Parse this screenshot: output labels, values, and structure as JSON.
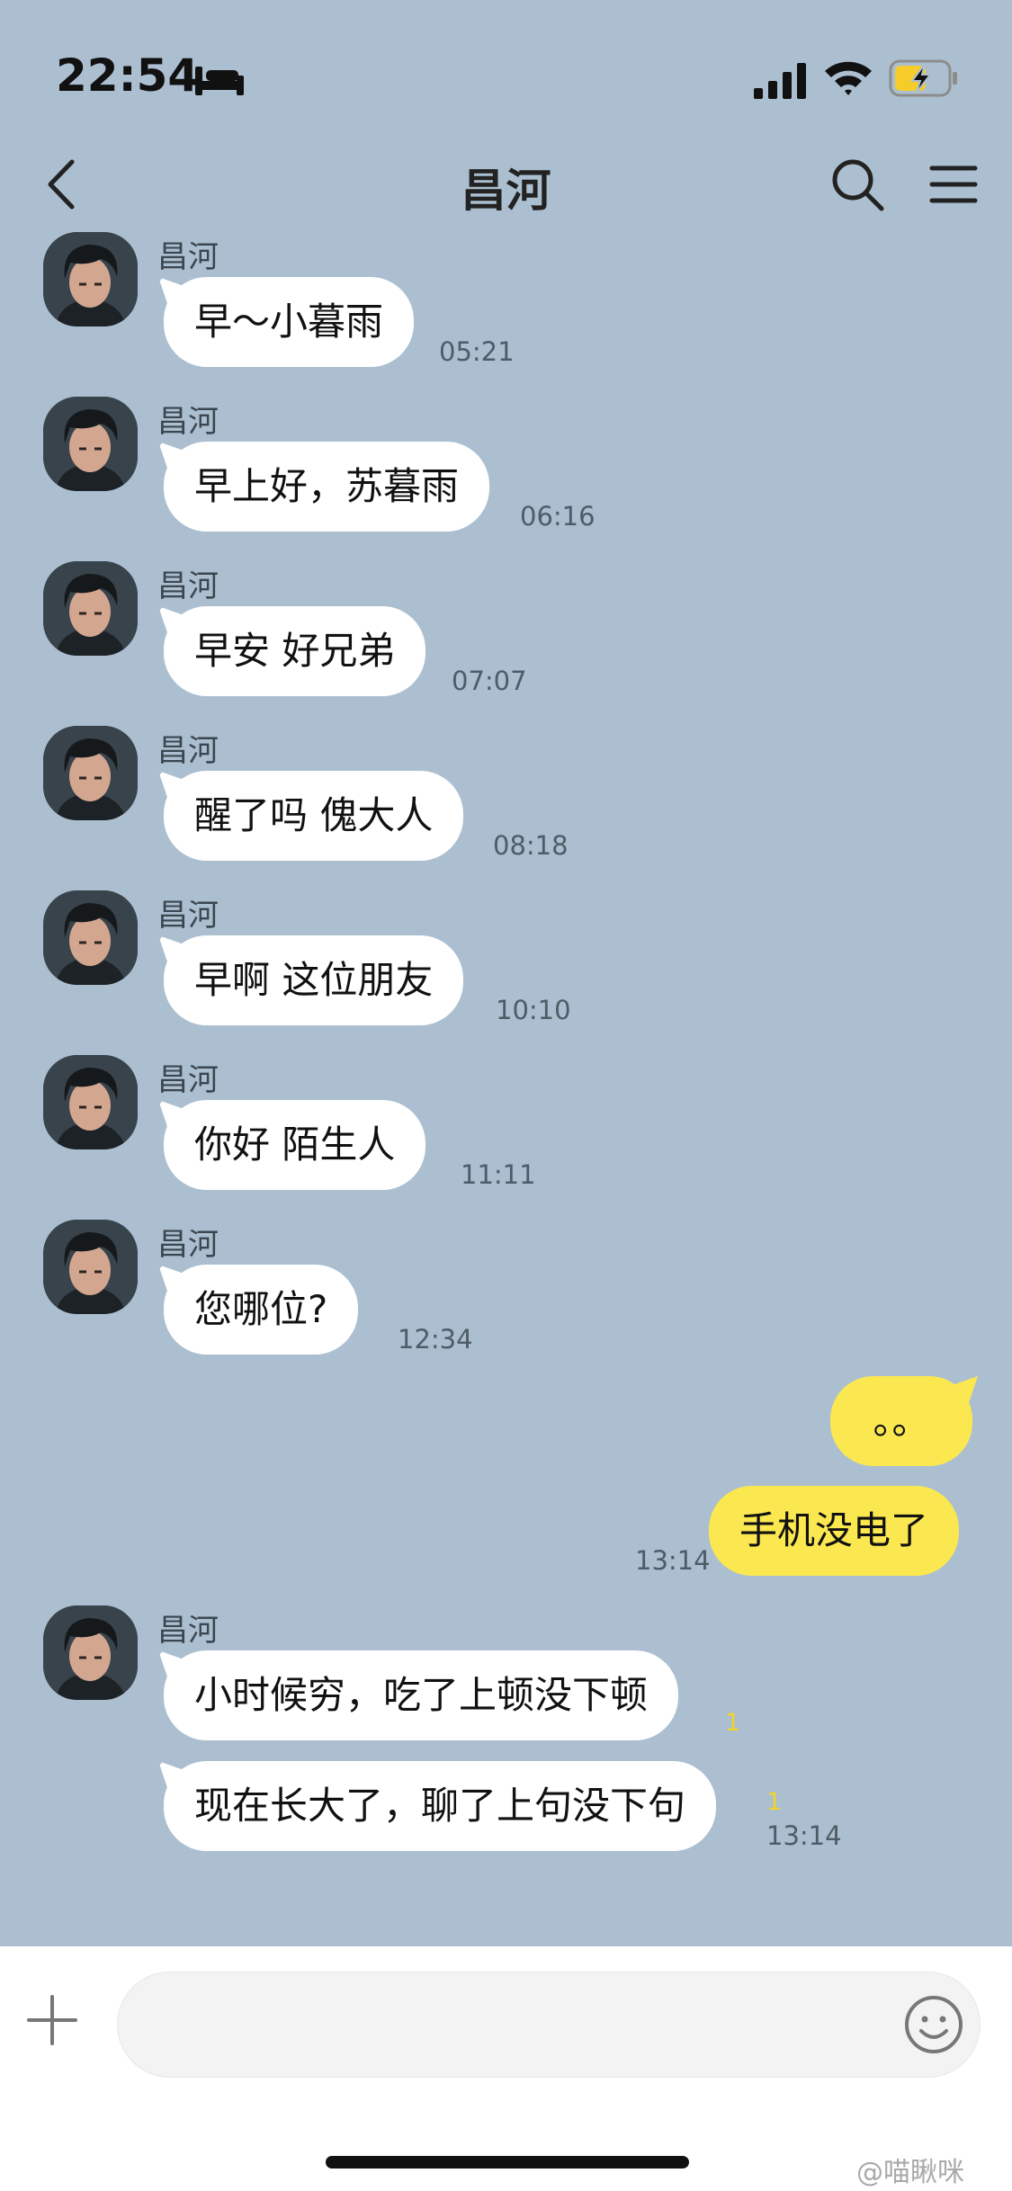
{
  "status_bar": {
    "time": "22:54"
  },
  "header": {
    "title": "昌河"
  },
  "messages": [
    {
      "sender": "昌河",
      "text": "早～小暮雨",
      "time": "05:21"
    },
    {
      "sender": "昌河",
      "text": "早上好，苏暮雨",
      "time": "06:16"
    },
    {
      "sender": "昌河",
      "text": "早安 好兄弟",
      "time": "07:07"
    },
    {
      "sender": "昌河",
      "text": "醒了吗 傀大人",
      "time": "08:18"
    },
    {
      "sender": "昌河",
      "text": "早啊 这位朋友",
      "time": "10:10"
    },
    {
      "sender": "昌河",
      "text": "你好 陌生人",
      "time": "11:11"
    },
    {
      "sender": "昌河",
      "text": "您哪位?",
      "time": "12:34"
    }
  ],
  "outgoing": [
    {
      "text": "。。"
    },
    {
      "text": "手机没电了",
      "time": "13:14"
    }
  ],
  "last_group": {
    "sender": "昌河",
    "first": {
      "text": "小时候穷，吃了上顿没下顿",
      "unread": "1"
    },
    "second": {
      "text": "现在长大了，聊了上句没下句",
      "unread": "1",
      "time": "13:14"
    }
  },
  "input": {
    "value": ""
  },
  "watermark": "@喵瞅咪",
  "colors": {
    "background": "#abbfd0",
    "outgoing_bubble": "#fbe851",
    "incoming_bubble": "#ffffff",
    "unread": "#f2d32a"
  }
}
